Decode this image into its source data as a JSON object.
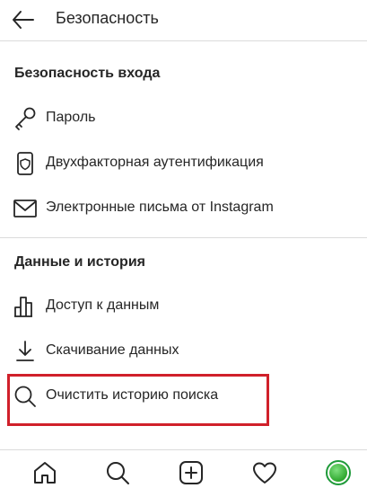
{
  "header": {
    "title": "Безопасность",
    "back_icon": "arrow-left-icon"
  },
  "sections": [
    {
      "heading": "Безопасность входа",
      "items": [
        {
          "label": "Пароль",
          "icon": "key-icon"
        },
        {
          "label": "Двухфакторная аутентификация",
          "icon": "phone-shield-icon"
        },
        {
          "label": "Электронные письма от Instagram",
          "icon": "envelope-icon"
        }
      ]
    },
    {
      "heading": "Данные и история",
      "items": [
        {
          "label": "Доступ к данным",
          "icon": "bar-chart-icon"
        },
        {
          "label": "Скачивание данных",
          "icon": "download-icon"
        },
        {
          "label": "Очистить историю поиска",
          "icon": "search-icon"
        }
      ]
    }
  ],
  "tabbar": {
    "items": [
      "home-icon",
      "search-icon",
      "new-post-icon",
      "heart-icon",
      "profile-avatar"
    ]
  },
  "colors": {
    "highlight": "#d0202a",
    "text": "#262626",
    "divider": "#dbdbdb",
    "avatar": "#2fa82f"
  }
}
